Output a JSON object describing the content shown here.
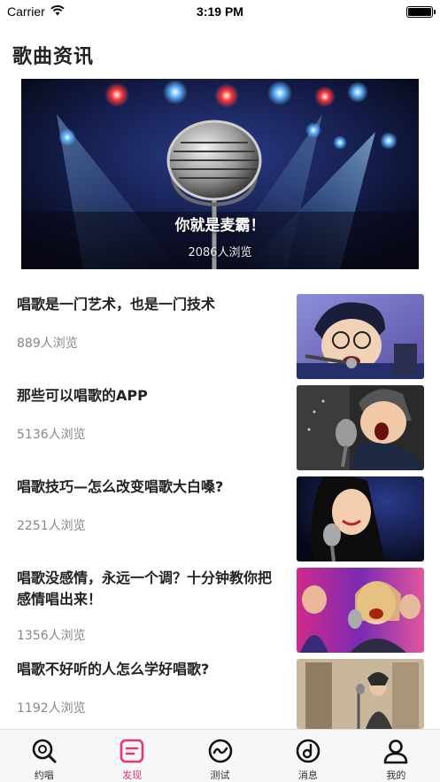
{
  "status_bar": {
    "carrier": "Carrier",
    "time": "3:19 PM"
  },
  "page_title": "歌曲资讯",
  "banner": {
    "title": "你就是麦霸！",
    "views": "2086人浏览"
  },
  "news": [
    {
      "title": "唱歌是一门艺术，也是一门技术",
      "views": "889人浏览"
    },
    {
      "title": "那些可以唱歌的APP",
      "views": "5136人浏览"
    },
    {
      "title": "唱歌技巧—怎么改变唱歌大白嗓?",
      "views": "2251人浏览"
    },
    {
      "title": "唱歌没感情，永远一个调？十分钟教你把感情唱出来！",
      "views": "1356人浏览"
    },
    {
      "title": "唱歌不好听的人怎么学好唱歌?",
      "views": "1192人浏览"
    }
  ],
  "tab_bar": {
    "active_color": "#e8356b",
    "tabs": [
      {
        "label": "约唱",
        "icon": "search-mic-icon"
      },
      {
        "label": "发现",
        "icon": "discover-icon"
      },
      {
        "label": "测试",
        "icon": "test-wave-icon"
      },
      {
        "label": "消息",
        "icon": "message-note-icon"
      },
      {
        "label": "我的",
        "icon": "user-icon"
      }
    ]
  }
}
